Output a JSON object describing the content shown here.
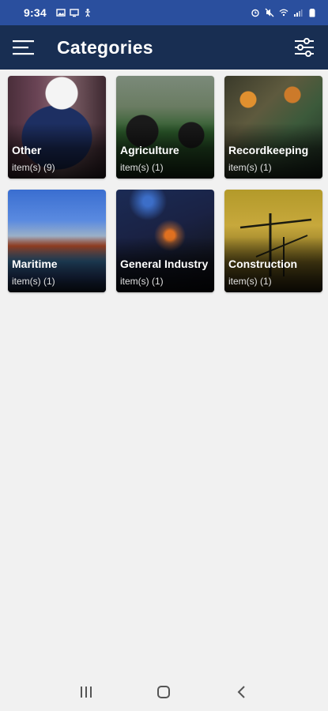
{
  "status_bar": {
    "time": "9:34"
  },
  "app_bar": {
    "title": "Categories",
    "menu_icon": "hamburger-menu-icon",
    "filter_icon": "sliders-filter-icon"
  },
  "categories": [
    {
      "title": "Other",
      "count": "item(s) (9)"
    },
    {
      "title": "Agriculture",
      "count": "item(s) (1)"
    },
    {
      "title": "Recordkeeping",
      "count": "item(s) (1)"
    },
    {
      "title": "Maritime",
      "count": "item(s) (1)"
    },
    {
      "title": "General Industry",
      "count": "item(s) (1)"
    },
    {
      "title": "Construction",
      "count": "item(s) (1)"
    }
  ],
  "colors": {
    "status_bar": "#2a4f9e",
    "app_bar": "#182e52",
    "background": "#f1f1f1"
  },
  "nav_bar": {
    "recents_icon": "recents-icon",
    "home_icon": "home-icon",
    "back_icon": "back-icon"
  }
}
